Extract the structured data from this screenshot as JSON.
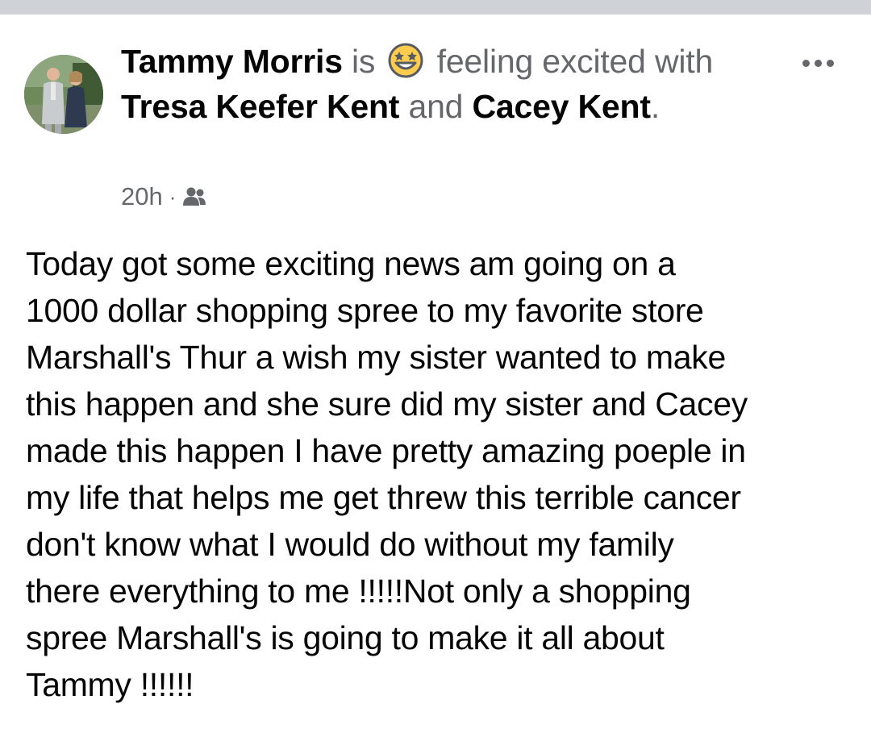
{
  "post": {
    "author": "Tammy Morris",
    "is_word": "is",
    "feeling_emoji": "star-struck-emoji-icon",
    "feeling_text": "feeling excited",
    "with_word": "with",
    "tagged": [
      "Tresa Keefer Kent",
      "Cacey Kent"
    ],
    "and_word": "and",
    "period": ".",
    "timestamp": "20h",
    "separator": "·",
    "audience_icon": "friends-icon",
    "more_icon": "more-horizontal-icon",
    "body_lines": [
      "Today got some exciting news am going on a",
      "1000 dollar shopping spree to my favorite store",
      "Marshall's Thur a wish my sister wanted to make",
      "this happen and she sure did my sister and Cacey",
      "made this happen I have pretty amazing poeple in",
      "my life that helps me get threw this terrible cancer",
      "don't know what I would do without my family",
      "there everything to me !!!!!Not only a shopping",
      "spree Marshall's is going to make it all about",
      "Tammy !!!!!!"
    ]
  },
  "colors": {
    "text_primary": "#050505",
    "text_secondary": "#65676b",
    "top_strip": "#cfd2d7",
    "emoji_yellow": "#ffcc4d"
  }
}
